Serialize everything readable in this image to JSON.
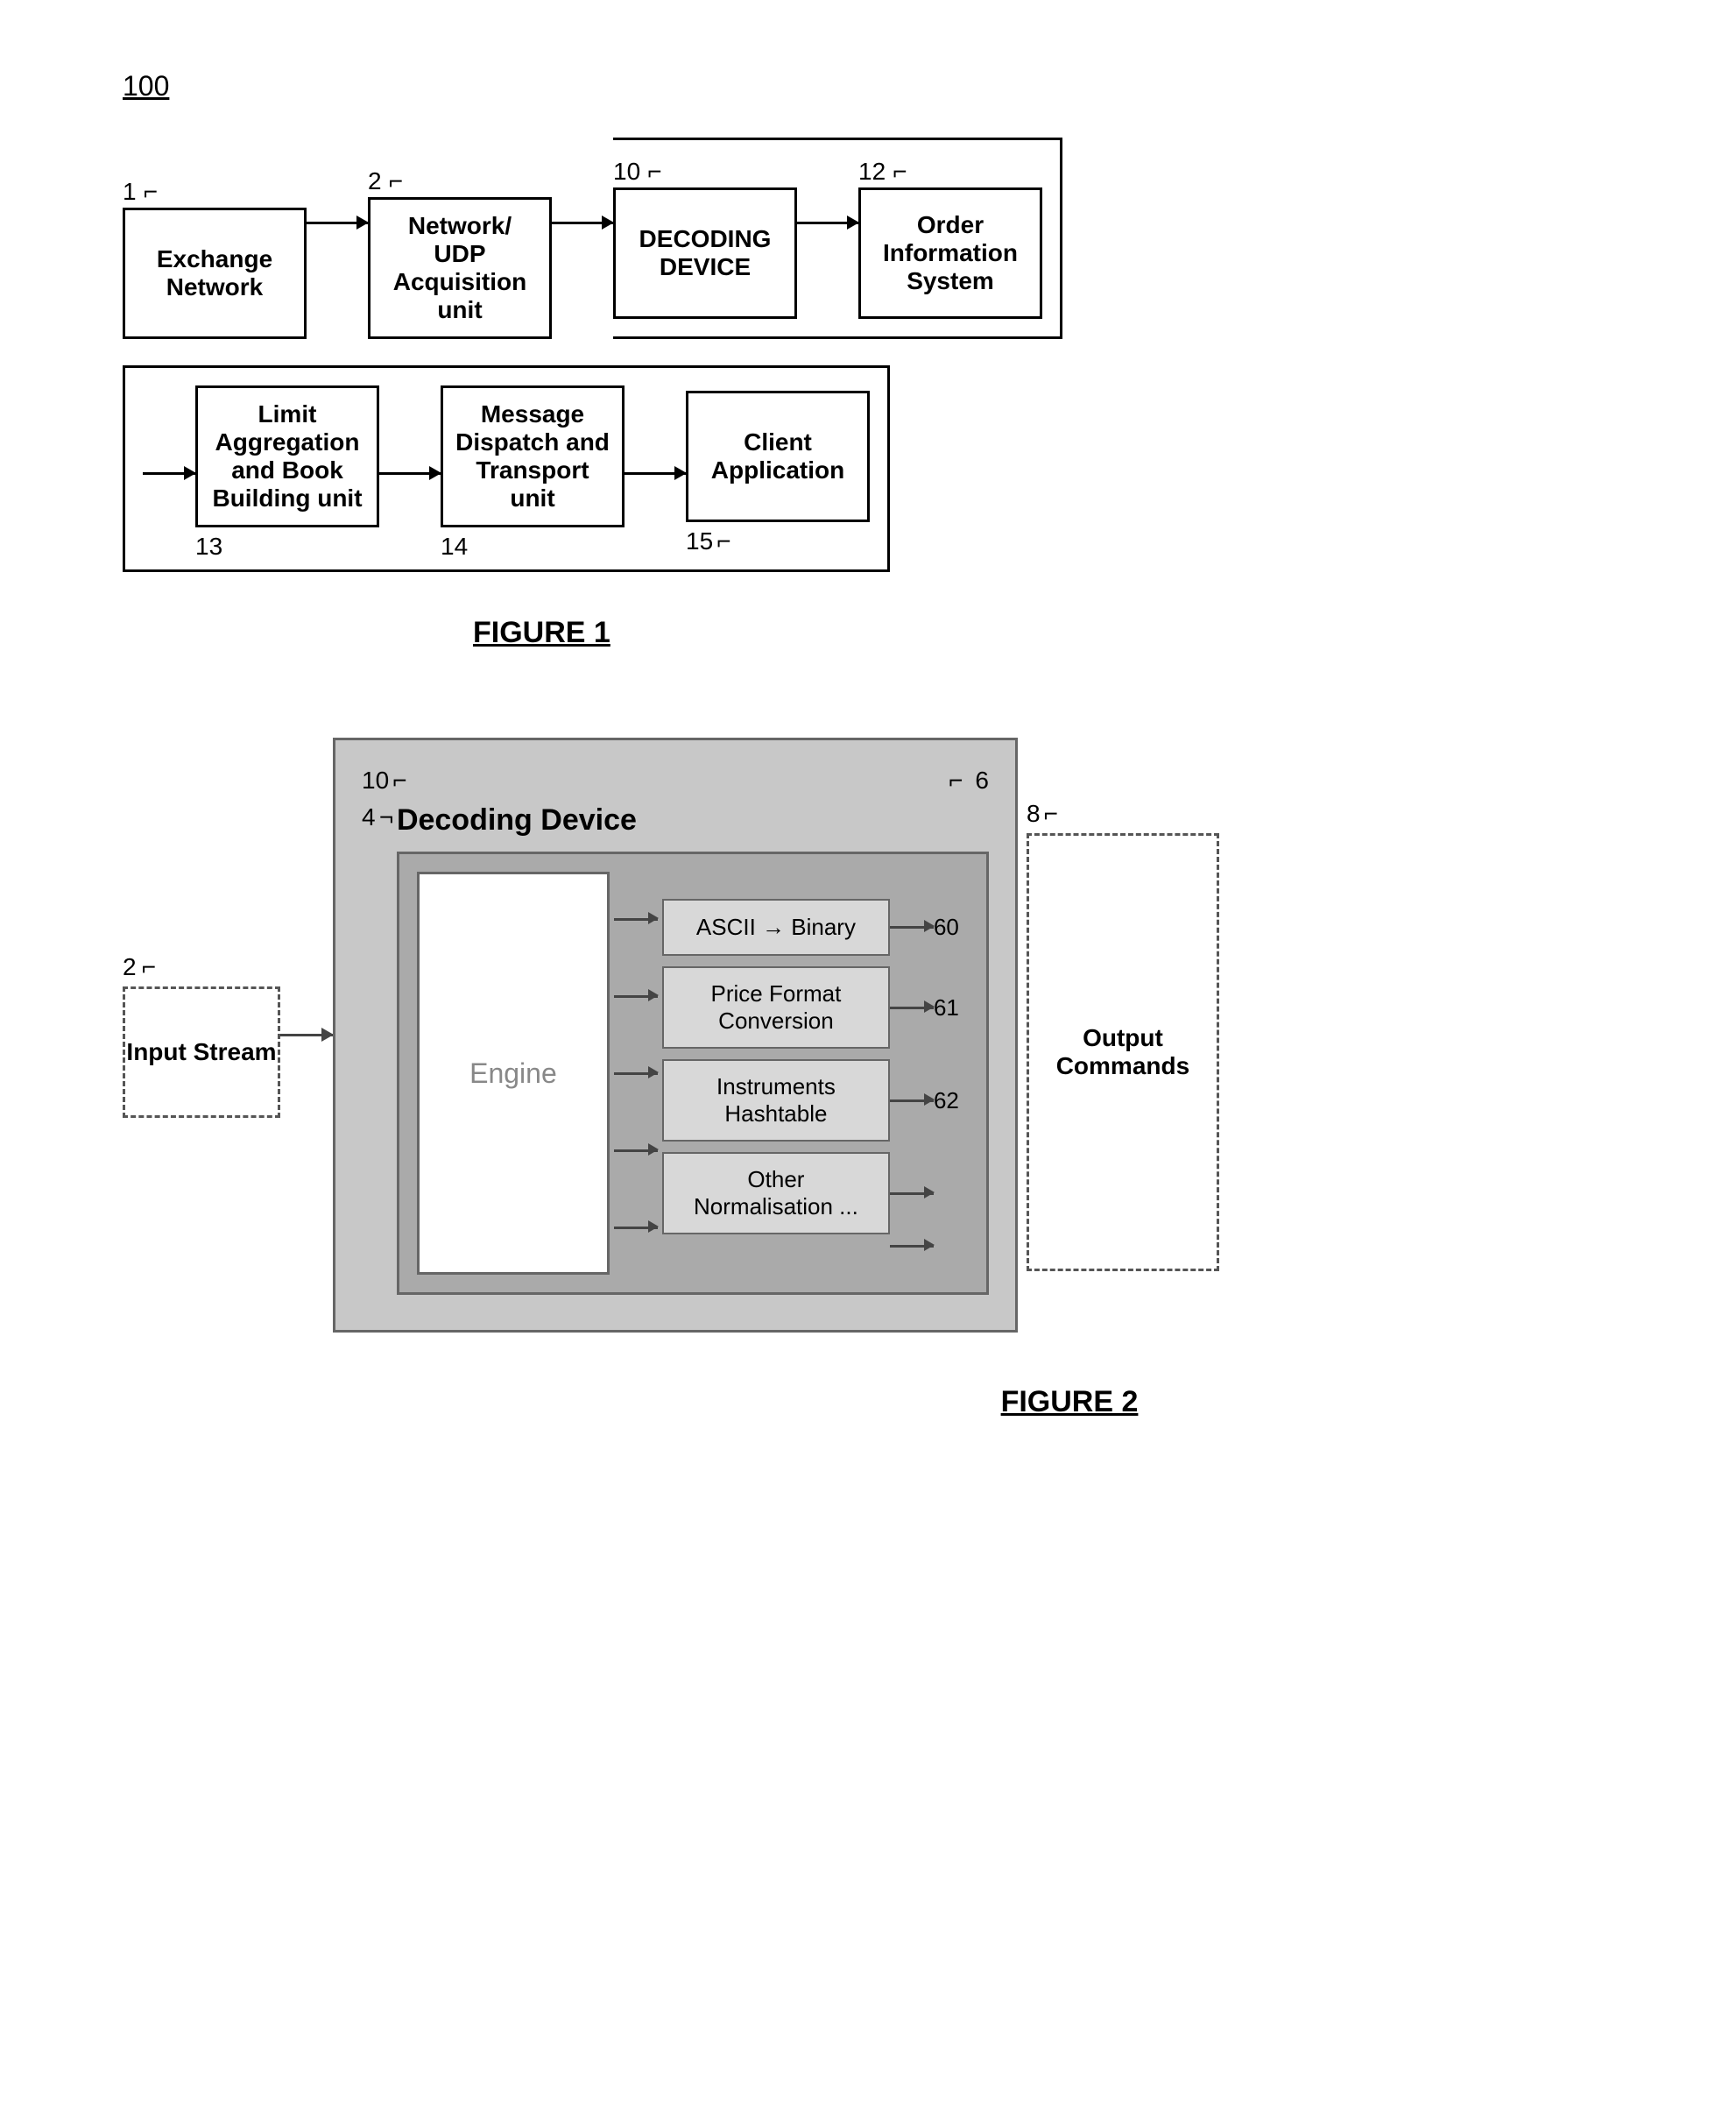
{
  "system_label": "100",
  "figure1": {
    "caption": "FIGURE 1",
    "row1": {
      "nodes": [
        {
          "num": "1",
          "label": "Exchange\nNetwork"
        },
        {
          "num": "2",
          "label": "Network/\nUDP\nAcquisition\nunit"
        },
        {
          "num": "10",
          "label": "DECODING\nDEVICE"
        },
        {
          "num": "12",
          "label": "Order\nInformation\nSystem"
        }
      ]
    },
    "row2": {
      "nodes": [
        {
          "num": "13",
          "label": "Limit\nAggregation\nand Book\nBuilding unit"
        },
        {
          "num": "14",
          "label": "Message\nDispatch and\nTransport unit"
        },
        {
          "num": "15",
          "label": "Client\nApplication"
        }
      ]
    }
  },
  "figure2": {
    "caption": "FIGURE 2",
    "label_10": "10",
    "label_6": "6",
    "label_4": "4",
    "label_2": "2",
    "label_8": "8",
    "decoding_title": "Decoding Device",
    "input_stream_label": "Input Stream",
    "engine_label": "Engine",
    "output_commands_label": "Output Commands",
    "modules": [
      {
        "id": "m1",
        "label": "ASCII → Binary",
        "out_num": "60"
      },
      {
        "id": "m2",
        "label": "Price Format\nConversion",
        "out_num": "61"
      },
      {
        "id": "m3",
        "label": "Instruments\nHashtable",
        "out_num": "62"
      },
      {
        "id": "m4",
        "label": "Other\nNormalisation ...",
        "out_num": ""
      }
    ]
  }
}
